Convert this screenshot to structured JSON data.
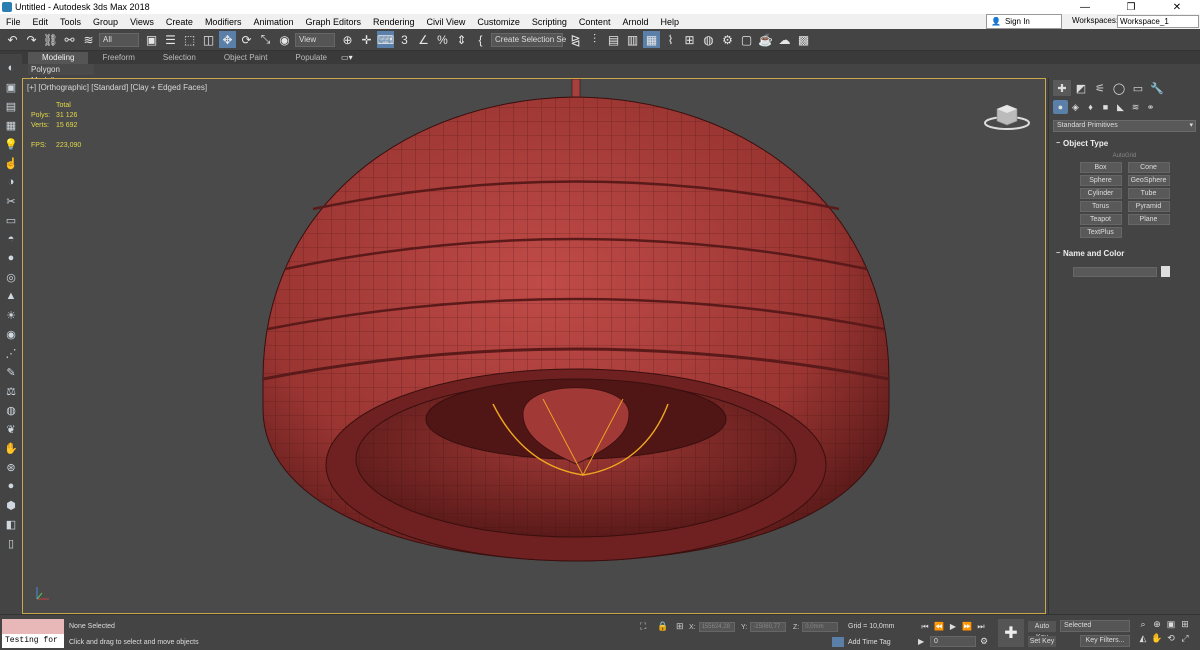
{
  "window": {
    "title": "Untitled - Autodesk 3ds Max 2018",
    "minimize": "—",
    "restore": "❐",
    "close": "✕"
  },
  "menu": {
    "items": [
      "File",
      "Edit",
      "Tools",
      "Group",
      "Views",
      "Create",
      "Modifiers",
      "Animation",
      "Graph Editors",
      "Rendering",
      "Civil View",
      "Customize",
      "Scripting",
      "Content",
      "Arnold",
      "Help"
    ],
    "sign_in": "Sign In",
    "workspaces_label": "Workspaces:",
    "workspace_value": "Workspace_1"
  },
  "toolbar": {
    "filter_value": "All",
    "refcoord_value": "View",
    "create_selection_set": "Create Selection Se",
    "snap_label": "3"
  },
  "ribbon": {
    "tabs": [
      "Modeling",
      "Freeform",
      "Selection",
      "Object Paint",
      "Populate"
    ],
    "active_tab": 0,
    "subtab": "Polygon Modeling"
  },
  "viewport": {
    "label": "[+] [Orthographic] [Standard] [Clay + Edged Faces]",
    "stats": {
      "total_label": "Total",
      "polys_label": "Polys:",
      "polys_value": "31 126",
      "verts_label": "Verts:",
      "verts_value": "15 692",
      "fps_label": "FPS:",
      "fps_value": "223,090"
    }
  },
  "command_panel": {
    "category": "Standard Primitives",
    "object_type_title": "Object Type",
    "autogrid": "AutoGrid",
    "buttons": [
      "Box",
      "Cone",
      "Sphere",
      "GeoSphere",
      "Cylinder",
      "Tube",
      "Torus",
      "Pyramid",
      "Teapot",
      "Plane",
      "TextPlus"
    ],
    "name_color_title": "Name and Color"
  },
  "status": {
    "listener_text": "Testing for :",
    "selection": "None Selected",
    "prompt": "Click and drag to select and move objects",
    "x_label": "X:",
    "x_value": "155624,28",
    "y_label": "Y:",
    "y_value": "-15060,77",
    "z_label": "Z:",
    "z_value": "0,0mm",
    "grid": "Grid = 10,0mm",
    "add_time_tag": "Add Time Tag",
    "frame": "0",
    "auto_key": "Auto Key",
    "set_key": "Set Key",
    "selected_dd": "Selected",
    "key_filters": "Key Filters..."
  },
  "colors": {
    "lamp": "#b0413e",
    "lamp_dark": "#6e2120",
    "selection_outline": "#f0a820",
    "viewport_bg": "#4a4a4a",
    "viewport_border": "#c8a84a"
  }
}
